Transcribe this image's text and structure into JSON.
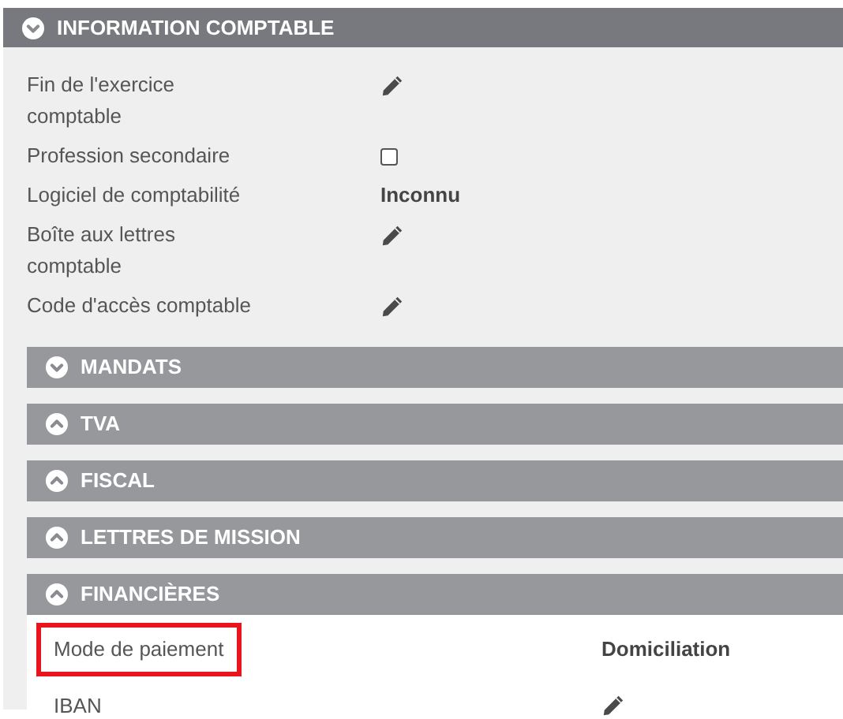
{
  "section": {
    "title": "INFORMATION COMPTABLE",
    "expanded": true,
    "rows": [
      {
        "label": "Fin de l'exercice comptable",
        "kind": "edit"
      },
      {
        "label": "Profession secondaire",
        "kind": "checkbox",
        "checked": false
      },
      {
        "label": "Logiciel de comptabilité",
        "kind": "text",
        "value": "Inconnu"
      },
      {
        "label": "Boîte aux lettres comptable",
        "kind": "edit"
      },
      {
        "label": "Code d'accès comptable",
        "kind": "edit"
      }
    ],
    "subsections": [
      {
        "title": "MANDATS",
        "expanded": true
      },
      {
        "title": "TVA",
        "expanded": false
      },
      {
        "title": "FISCAL",
        "expanded": false
      },
      {
        "title": "LETTRES DE MISSION",
        "expanded": false
      },
      {
        "title": "FINANCIÈRES",
        "expanded": false,
        "rows": [
          {
            "label": "Mode de paiement",
            "highlighted": true,
            "kind": "text",
            "value": "Domiciliation"
          },
          {
            "label": "IBAN",
            "highlighted": false,
            "kind": "edit"
          }
        ]
      }
    ]
  }
}
